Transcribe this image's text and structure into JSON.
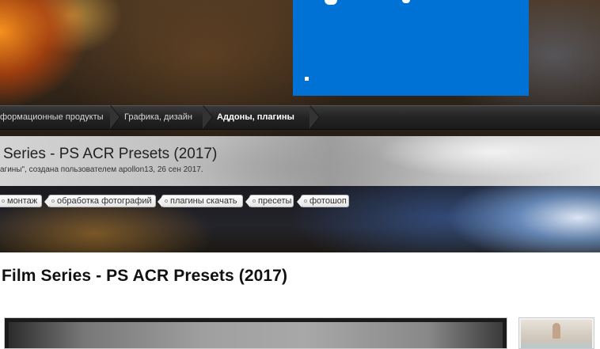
{
  "breadcrumb": {
    "items": [
      {
        "label": "формационные продукты"
      },
      {
        "label": "Графика, дизайн"
      },
      {
        "label": "Аддоны, плагины"
      }
    ]
  },
  "thread": {
    "title": "Series - PS ACR Presets (2017)",
    "meta": "агины\", создана пользователем apollon13, 26 сен 2017."
  },
  "tags": [
    {
      "label": "монтаж"
    },
    {
      "label": "обработка фотографий"
    },
    {
      "label": "плагины скачать"
    },
    {
      "label": "пресеты"
    },
    {
      "label": "фотошоп"
    }
  ],
  "post": {
    "title": "Film Series - PS ACR Presets (2017)"
  },
  "colors": {
    "ad_background": "#0072d6",
    "breadcrumb_background": "#242424",
    "breadcrumb_current": "#ffffff"
  }
}
